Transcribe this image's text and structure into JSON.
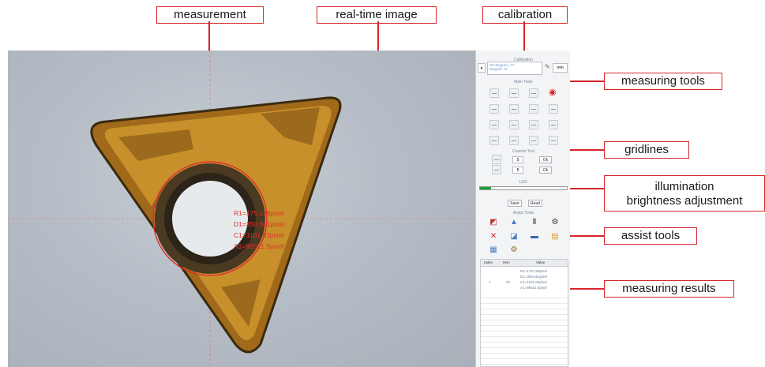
{
  "callouts": {
    "measurement": "measurement",
    "realtime": "real-time image",
    "calibration": "calibration",
    "measuring_tools": "measuring tools",
    "gridlines": "gridlines",
    "illumination_line1": "illumination",
    "illumination_line2": "brightness adjustment",
    "assist_tools": "assist tools",
    "measuring_results": "measuring results"
  },
  "overlay": {
    "r": "R1=175.126pixel",
    "d": "D1=350.651pixel",
    "c": "C1=1101.83pixel",
    "a": "A1=96521.5pixel"
  },
  "panel": {
    "calibration_title": "Calibration",
    "calibration_text1": "GT-MagnG-(.77",
    "calibration_text2": "Wegehl: 22",
    "unit": "mm",
    "main_tools_title": "Main Tools",
    "custom_tool_title": "Custom Tool",
    "spin1": "5",
    "spin2": "5",
    "ok1": "Ok",
    "ok2": "Ok",
    "led_title": "LED",
    "save": "Save",
    "read": "Read",
    "assist_title": "Assist Tools",
    "table": {
      "headers": [
        "Index",
        "Item",
        "Value"
      ],
      "index": "1",
      "item": "Cir",
      "values": [
        "R1=175.126pixel",
        "D1=350.651pixel",
        "C1=1101.83pixel",
        "A1=96521.5pixel"
      ]
    }
  },
  "colors": {
    "callout_border": "#d7262b",
    "overlay_text": "#e03030",
    "insert_gold": "#c8902a"
  },
  "icons": [
    "pencil-icon",
    "eye-icon",
    "tool-icon",
    "color-palette-icon",
    "triangle-icon",
    "pause-icon",
    "gear-icon",
    "close-icon",
    "image-icon",
    "crop-icon",
    "folder-icon"
  ]
}
